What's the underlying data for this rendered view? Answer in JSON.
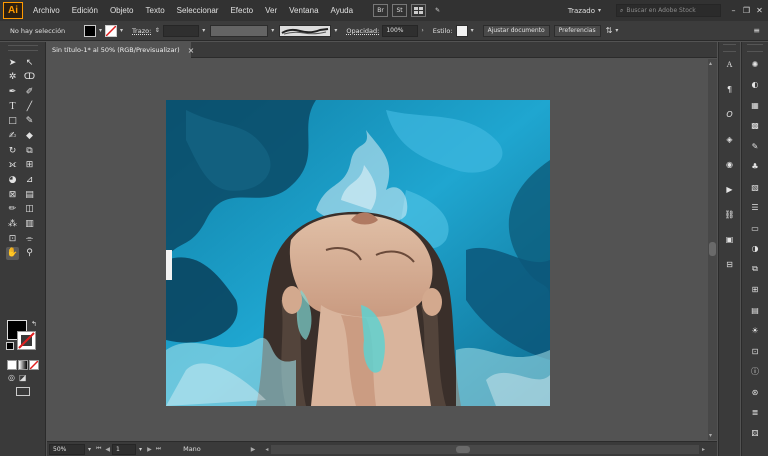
{
  "app": {
    "logo": "Ai"
  },
  "menu": [
    "Archivo",
    "Edición",
    "Objeto",
    "Texto",
    "Seleccionar",
    "Efecto",
    "Ver",
    "Ventana",
    "Ayuda"
  ],
  "menubar_icons": [
    "Br",
    "St"
  ],
  "workspace": {
    "label": "Trazado"
  },
  "search": {
    "placeholder": "Buscar en Adobe Stock"
  },
  "control": {
    "selection_status": "No hay selección",
    "stroke_label": "Trazo:",
    "opacity_label": "Opacidad:",
    "opacity_value": "100%",
    "style_label": "Estilo:",
    "adjust_button": "Ajustar documento",
    "prefs_button": "Preferencias"
  },
  "document_tab": {
    "title": "Sin título-1* al 50% (RGB/Previsualizar)",
    "close": "×"
  },
  "status": {
    "zoom": "50%",
    "page": "1",
    "tool": "Mano"
  },
  "colors": {
    "accent": "#ff9a00",
    "chrome_dark": "#323232",
    "panel": "#3a3a3a",
    "canvas": "#535353",
    "artboard_blue": "#1c9fc7"
  },
  "tools": [
    "selection-icon",
    "direct-selection-icon",
    "magic-wand-icon",
    "lasso-icon",
    "pen-icon",
    "curvature-icon",
    "type-icon",
    "line-icon",
    "rectangle-icon",
    "paintbrush-icon",
    "shaper-icon",
    "eraser-icon",
    "rotate-icon",
    "scale-icon",
    "width-icon",
    "free-transform-icon",
    "shape-builder-icon",
    "perspective-icon",
    "mesh-icon",
    "gradient-icon",
    "eyedropper-icon",
    "blend-icon",
    "symbol-sprayer-icon",
    "graph-icon",
    "artboard-icon",
    "slice-icon",
    "hand-icon",
    "zoom-icon"
  ],
  "right_panel_1": [
    "character-icon",
    "paragraph-icon",
    "opentype-icon",
    "layers-icon",
    "appearance-icon",
    "actions-icon",
    "links-icon",
    "libraries-icon",
    "align-icon",
    "transform-icon"
  ],
  "right_panel_2": [
    "properties-icon",
    "color-icon",
    "color-guide-icon",
    "swatches-icon",
    "brushes-icon",
    "symbols-icon",
    "graphic-styles-icon",
    "stroke-icon",
    "gradient-panel-icon",
    "transparency-icon",
    "pathfinder-icon",
    "asset-export-icon",
    "artboards-panel-icon",
    "image-trace-icon",
    "variables-icon",
    "document-info-icon",
    "navigator-icon",
    "attributes-icon",
    "magic-wand-panel-icon"
  ]
}
